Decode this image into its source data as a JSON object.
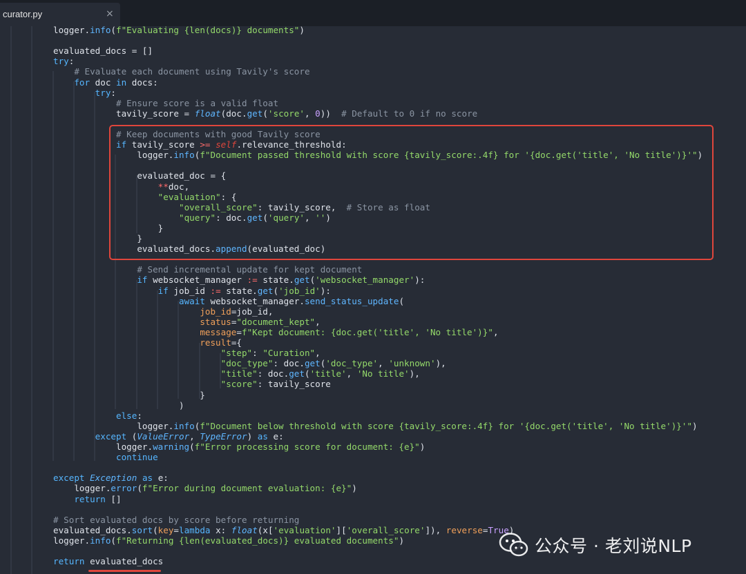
{
  "tab": {
    "filename": "curator.py",
    "close_glyph": "×"
  },
  "code": [
    "logger.info(f\"Evaluating {len(docs)} documents\")",
    "",
    "evaluated_docs = []",
    "try:",
    "    # Evaluate each document using Tavily's score",
    "    for doc in docs:",
    "        try:",
    "            # Ensure score is a valid float",
    "            tavily_score = float(doc.get('score', 0))  # Default to 0 if no score",
    "",
    "            # Keep documents with good Tavily score",
    "            if tavily_score >= self.relevance_threshold:",
    "                logger.info(f\"Document passed threshold with score {tavily_score:.4f} for '{doc.get('title', 'No title')}'\")",
    "",
    "                evaluated_doc = {",
    "                    **doc,",
    "                    \"evaluation\": {",
    "                        \"overall_score\": tavily_score,  # Store as float",
    "                        \"query\": doc.get('query', '')",
    "                    }",
    "                }",
    "                evaluated_docs.append(evaluated_doc)",
    "",
    "                # Send incremental update for kept document",
    "                if websocket_manager := state.get('websocket_manager'):",
    "                    if job_id := state.get('job_id'):",
    "                        await websocket_manager.send_status_update(",
    "                            job_id=job_id,",
    "                            status=\"document_kept\",",
    "                            message=f\"Kept document: {doc.get('title', 'No title')}\",",
    "                            result={",
    "                                \"step\": \"Curation\",",
    "                                \"doc_type\": doc.get('doc_type', 'unknown'),",
    "                                \"title\": doc.get('title', 'No title'),",
    "                                \"score\": tavily_score",
    "                            }",
    "                        )",
    "            else:",
    "                logger.info(f\"Document below threshold with score {tavily_score:.4f} for '{doc.get('title', 'No title')}'\")",
    "        except (ValueError, TypeError) as e:",
    "            logger.warning(f\"Error processing score for document: {e}\")",
    "            continue",
    "",
    "except Exception as e:",
    "    logger.error(f\"Error during document evaluation: {e}\")",
    "    return []",
    "",
    "# Sort evaluated docs by score before returning",
    "evaluated_docs.sort(key=lambda x: float(x['evaluation']['overall_score']), reverse=True)",
    "logger.info(f\"Returning {len(evaluated_docs)} evaluated documents\")",
    "",
    "return evaluated_docs"
  ],
  "watermark": {
    "text": "公众号 · 老刘说NLP"
  },
  "colors": {
    "highlight": "#e0463c",
    "background": "#272c36",
    "tabbar": "#1b1f26"
  }
}
